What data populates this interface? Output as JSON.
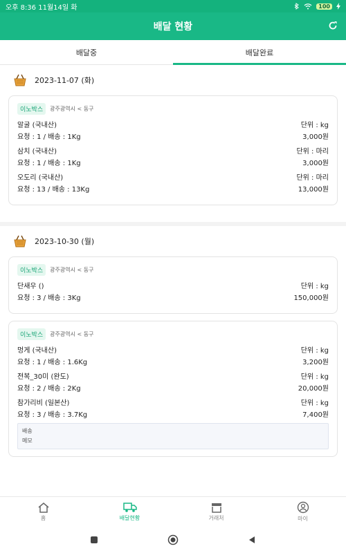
{
  "statusbar": {
    "time_text": "오후 8:36 11월14일 화",
    "battery": "100"
  },
  "header": {
    "title": "배달 현황"
  },
  "tabs": [
    {
      "label": "배달중",
      "active": false
    },
    {
      "label": "배달완료",
      "active": true
    }
  ],
  "groups": [
    {
      "date": "2023-11-07 (화)",
      "cards": [
        {
          "store": "이노박스",
          "region": "광주광역시 < 동구",
          "items": [
            {
              "name": "알굴 (국내산)",
              "qty": "요청 : 1 / 배송 : 1Kg",
              "unit": "단위 : kg",
              "price": "3,000원"
            },
            {
              "name": "삼치 (국내산)",
              "qty": "요청 : 1 / 배송 : 1Kg",
              "unit": "단위 : 마리",
              "price": "3,000원"
            },
            {
              "name": "오도리 (국내산)",
              "qty": "요청 : 13 / 배송 : 13Kg",
              "unit": "단위 : 마리",
              "price": "13,000원"
            }
          ]
        }
      ]
    },
    {
      "date": "2023-10-30 (월)",
      "cards": [
        {
          "store": "이노박스",
          "region": "광주광역시 < 동구",
          "items": [
            {
              "name": "단새우 ()",
              "qty": "요청 : 3 / 배송 : 3Kg",
              "unit": "단위 : kg",
              "price": "150,000원"
            }
          ]
        },
        {
          "store": "이노박스",
          "region": "광주광역시 < 동구",
          "items": [
            {
              "name": "멍게 (국내산)",
              "qty": "요청 : 1 / 배송 : 1.6Kg",
              "unit": "단위 : kg",
              "price": "3,200원"
            },
            {
              "name": "전복_30미 (완도)",
              "qty": "요청 : 2 / 배송 : 2Kg",
              "unit": "단위 : kg",
              "price": "20,000원"
            },
            {
              "name": "참가리비 (일본산)",
              "qty": "요청 : 3 / 배송 : 3.7Kg",
              "unit": "단위 : kg",
              "price": "7,400원"
            }
          ],
          "memo": {
            "line1": "배송",
            "line2": "메모"
          }
        }
      ]
    }
  ],
  "bottom_nav": [
    {
      "label": "홈",
      "icon": "home-icon",
      "active": false
    },
    {
      "label": "배달현황",
      "icon": "truck-icon",
      "active": true
    },
    {
      "label": "거래처",
      "icon": "store-icon",
      "active": false
    },
    {
      "label": "마이",
      "icon": "user-icon",
      "active": false
    }
  ],
  "colors": {
    "primary": "#19b886",
    "statusbar": "#14b27d",
    "badge_bg": "#e4f7ef"
  }
}
